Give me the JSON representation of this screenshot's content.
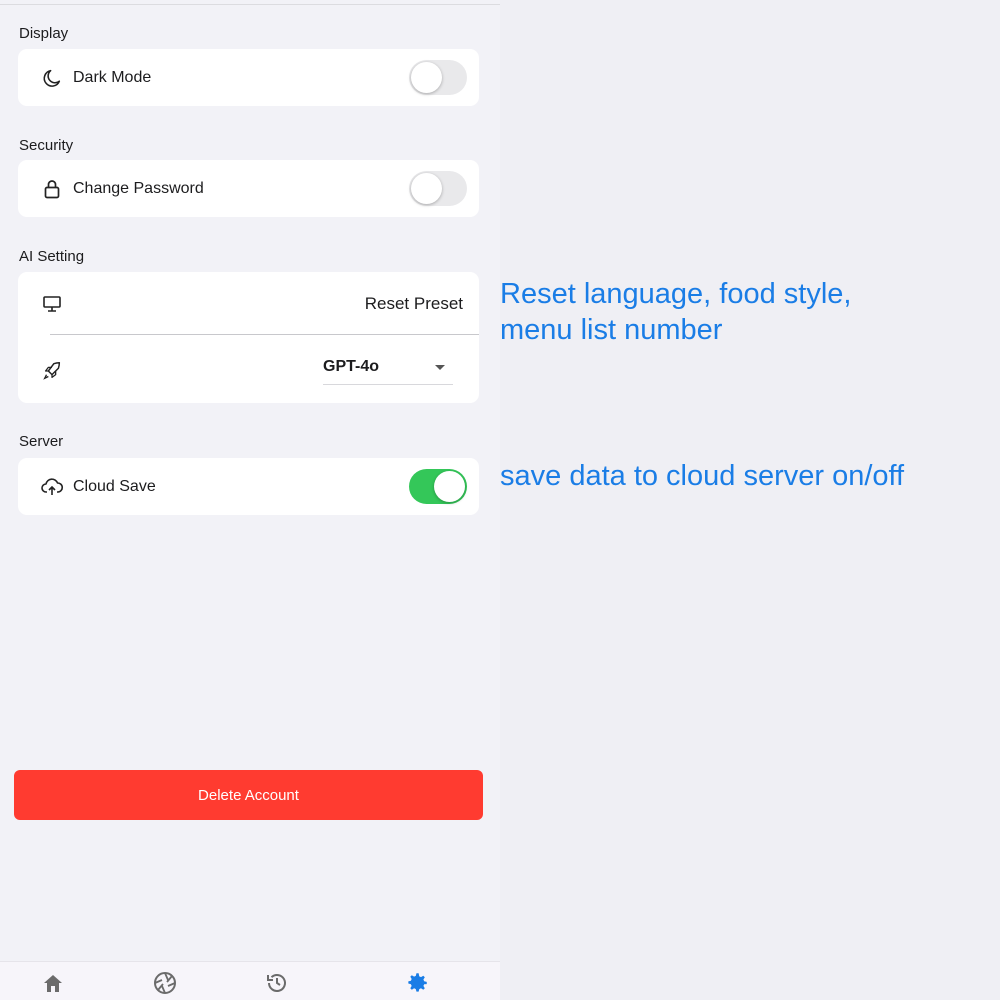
{
  "sections": {
    "display": {
      "label": "Display",
      "dark_mode": {
        "label": "Dark Mode",
        "on": false
      }
    },
    "security": {
      "label": "Security",
      "change_password": {
        "label": "Change Password",
        "on": false
      }
    },
    "ai": {
      "label": "AI Setting",
      "reset_label": "Reset Preset",
      "model_value": "GPT-4o"
    },
    "server": {
      "label": "Server",
      "cloud_save": {
        "label": "Cloud Save",
        "on": true
      }
    }
  },
  "delete_button": "Delete Account",
  "tabs": [
    {
      "icon": "home-icon"
    },
    {
      "icon": "camera-aperture-icon"
    },
    {
      "icon": "history-icon"
    },
    {
      "icon": "gear-icon",
      "active": true
    }
  ],
  "annotations": {
    "ai_note": "Reset language, food style, menu list number",
    "server_note": "save data to cloud server on/off"
  },
  "colors": {
    "accent": "#1a7de6",
    "toggle_on": "#34c759",
    "danger": "#ff3b30",
    "tab_active": "#1a7de6",
    "tab_inactive": "#6b6b6b"
  }
}
